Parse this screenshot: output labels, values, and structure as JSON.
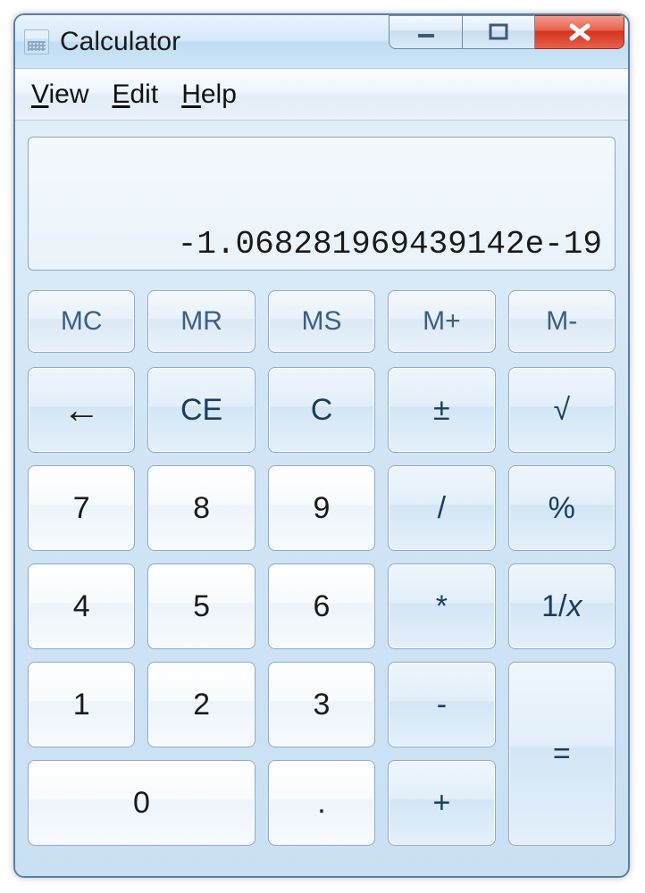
{
  "window": {
    "title": "Calculator"
  },
  "menu": {
    "view": "View",
    "edit": "Edit",
    "help": "Help"
  },
  "display": {
    "value": "-1.068281969439142e-19"
  },
  "memory_buttons": {
    "mc": "MC",
    "mr": "MR",
    "ms": "MS",
    "mplus": "M+",
    "mminus": "M-"
  },
  "buttons": {
    "backspace": "←",
    "ce": "CE",
    "c": "C",
    "negate": "±",
    "sqrt": "√",
    "seven": "7",
    "eight": "8",
    "nine": "9",
    "divide": "/",
    "percent": "%",
    "four": "4",
    "five": "5",
    "six": "6",
    "multiply": "*",
    "reciprocal": "1/x",
    "one": "1",
    "two": "2",
    "three": "3",
    "subtract": "-",
    "equals": "=",
    "zero": "0",
    "decimal": ".",
    "add": "+"
  }
}
